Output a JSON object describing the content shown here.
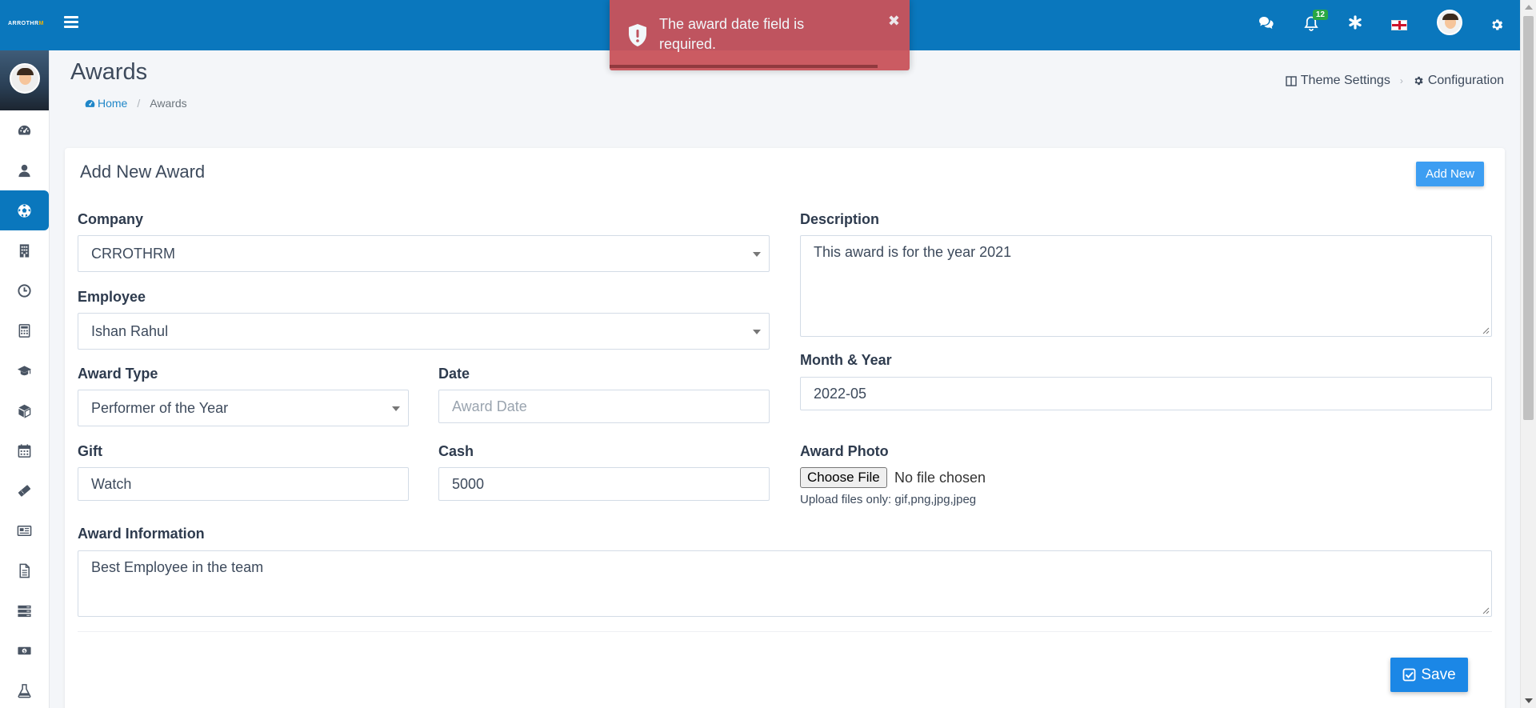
{
  "app": {
    "logo_text": "ARROTHR",
    "logo_accent": "M"
  },
  "topbar": {
    "notifications_count": "12",
    "icons": [
      "chat-icon",
      "bell-icon",
      "asterisk-icon",
      "flag-icon",
      "avatar",
      "gear-icon"
    ]
  },
  "sidebar": {
    "items": [
      {
        "name": "dashboard-icon",
        "active": false
      },
      {
        "name": "user-icon",
        "active": false
      },
      {
        "name": "ball-icon",
        "active": true
      },
      {
        "name": "building-icon",
        "active": false
      },
      {
        "name": "clock-icon",
        "active": false
      },
      {
        "name": "calculator-icon",
        "active": false
      },
      {
        "name": "graduation-cap-icon",
        "active": false
      },
      {
        "name": "box-icon",
        "active": false
      },
      {
        "name": "calendar-icon",
        "active": false
      },
      {
        "name": "ticket-icon",
        "active": false
      },
      {
        "name": "newspaper-icon",
        "active": false
      },
      {
        "name": "document-icon",
        "active": false
      },
      {
        "name": "server-icon",
        "active": false
      },
      {
        "name": "money-icon",
        "active": false
      },
      {
        "name": "flask-icon",
        "active": false
      }
    ]
  },
  "header": {
    "title": "Awards",
    "breadcrumb": {
      "home": "Home",
      "current": "Awards"
    },
    "links": {
      "theme_settings": "Theme Settings",
      "configuration": "Configuration"
    }
  },
  "form": {
    "title": "Add New Award",
    "add_new_label": "Add New",
    "company": {
      "label": "Company",
      "value": "CRROTHRM"
    },
    "employee": {
      "label": "Employee",
      "value": "Ishan Rahul"
    },
    "award_type": {
      "label": "Award Type",
      "value": "Performer of the Year"
    },
    "date": {
      "label": "Date",
      "placeholder": "Award Date"
    },
    "gift": {
      "label": "Gift",
      "value": "Watch"
    },
    "cash": {
      "label": "Cash",
      "value": "5000"
    },
    "award_information": {
      "label": "Award Information",
      "value": "Best Employee in the team"
    },
    "description": {
      "label": "Description",
      "value": "This award is for the year 2021"
    },
    "month_year": {
      "label": "Month & Year",
      "value": "2022-05"
    },
    "award_photo": {
      "label": "Award Photo",
      "button": "Choose File",
      "status": "No file chosen",
      "hint": "Upload files only: gif,png,jpg,jpeg"
    },
    "save_label": "Save"
  },
  "toast": {
    "message": "The award date field is required.",
    "close": "✖"
  },
  "colors": {
    "primary": "#0a77bd",
    "accent_button": "#3d9ef2",
    "error_toast": "#c9535a",
    "badge": "#28a745"
  }
}
